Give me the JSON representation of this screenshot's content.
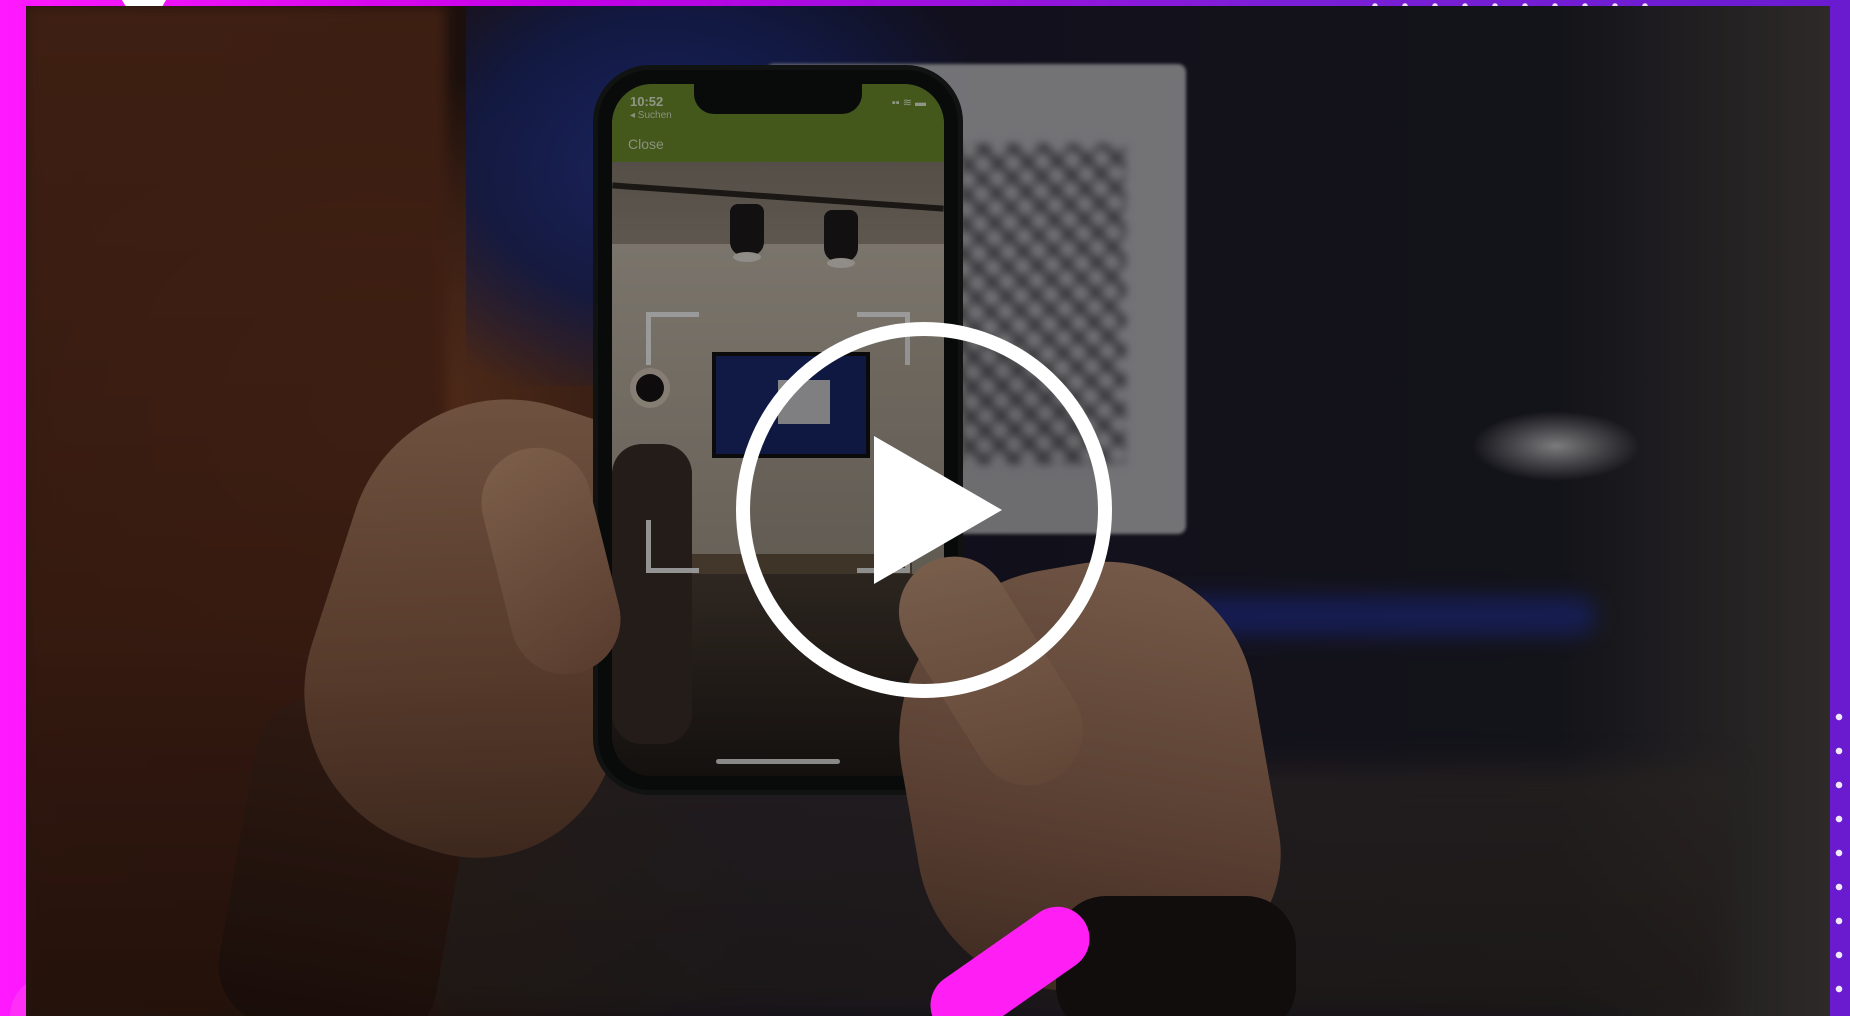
{
  "video": {
    "phone": {
      "status_time": "10:52",
      "status_sub": "◂ Suchen",
      "status_icons": "▪▪ ≋ ▬",
      "close_label": "Close"
    },
    "play_button_icon": "play-icon"
  },
  "colors": {
    "frame_magenta": "#ff19ff",
    "frame_purple": "#7a1fd6",
    "phone_header_green": "#6d8f2a",
    "play_white": "#ffffff"
  }
}
